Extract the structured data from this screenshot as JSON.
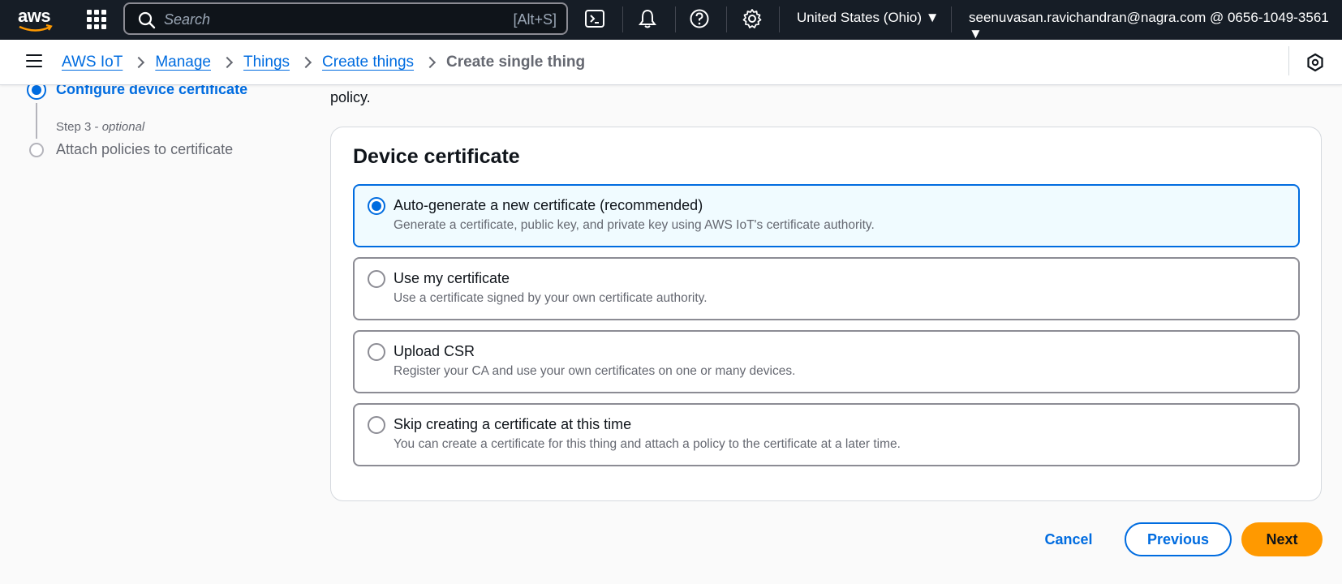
{
  "topnav": {
    "logo_text": "aws",
    "search_placeholder": "Search",
    "search_shortcut": "[Alt+S]",
    "region": "United States (Ohio) ▼",
    "account": "seenuvasan.ravichandran@nagra.com @ 0656-1049-3561 ▼",
    "icons": [
      "cloudshell-icon",
      "bell-icon",
      "help-icon",
      "settings-icon"
    ]
  },
  "breadcrumb": {
    "items": [
      "AWS IoT",
      "Manage",
      "Things",
      "Create things"
    ],
    "current": "Create single thing"
  },
  "steps": {
    "active_label": "Configure device certificate",
    "step3_prefix": "Step 3 - ",
    "step3_optional": "optional",
    "step3_label": "Attach policies to certificate"
  },
  "intro_tail": "policy.",
  "card": {
    "title": "Device certificate",
    "options": [
      {
        "title": "Auto-generate a new certificate (recommended)",
        "desc": "Generate a certificate, public key, and private key using AWS IoT's certificate authority.",
        "selected": true
      },
      {
        "title": "Use my certificate",
        "desc": "Use a certificate signed by your own certificate authority.",
        "selected": false
      },
      {
        "title": "Upload CSR",
        "desc": "Register your CA and use your own certificates on one or many devices.",
        "selected": false
      },
      {
        "title": "Skip creating a certificate at this time",
        "desc": "You can create a certificate for this thing and attach a policy to the certificate at a later time.",
        "selected": false
      }
    ]
  },
  "footer": {
    "cancel": "Cancel",
    "previous": "Previous",
    "next": "Next"
  },
  "colors": {
    "accent": "#006ce0",
    "primary_button": "#ff9900",
    "nav_bg": "#161d26"
  }
}
